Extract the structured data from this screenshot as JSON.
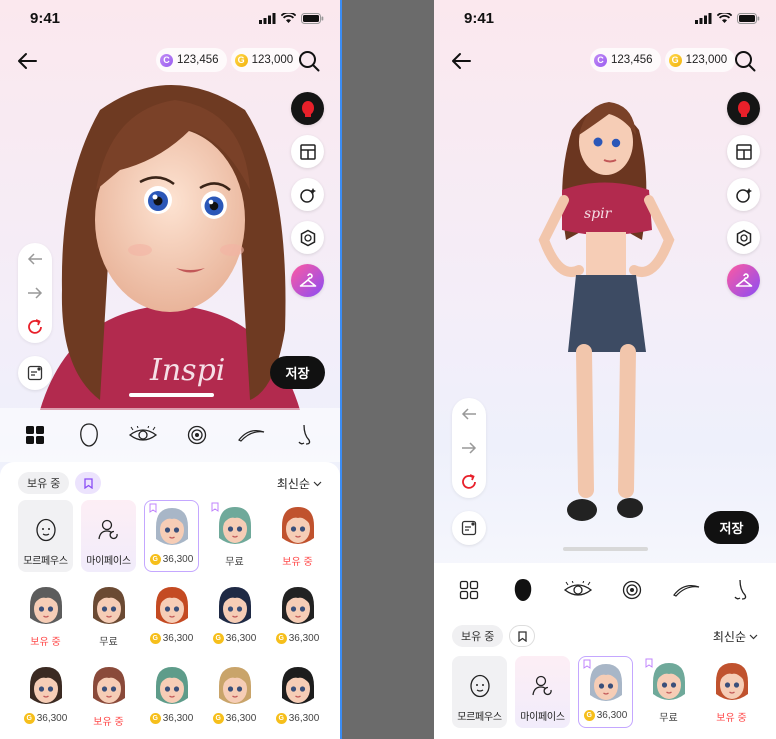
{
  "status": {
    "time": "9:41"
  },
  "currency": {
    "gem": "123,456",
    "gold": "123,000",
    "gem_symbol": "C",
    "gold_symbol": "G"
  },
  "actions": {
    "save_label": "저장"
  },
  "filter": {
    "owned_label": "보유 중",
    "sort_label": "최신순"
  },
  "items_left": [
    {
      "type": "tile",
      "label": "모르페우스",
      "icon": "face-outline-icon"
    },
    {
      "type": "tile",
      "label": "마이페이스",
      "icon": "person-refresh-icon"
    },
    {
      "type": "face",
      "price": "36,300",
      "selected": true,
      "hair": "#a8b6c7",
      "bookmark": true
    },
    {
      "type": "face",
      "label": "무료",
      "hair": "#6fa99a",
      "bookmark": true
    },
    {
      "type": "face",
      "label": "보유 중",
      "owned": true,
      "hair": "#c0522e"
    },
    {
      "type": "face",
      "label": "보유 중",
      "owned": true,
      "hair": "#5c5c5c"
    },
    {
      "type": "face",
      "label": "무료",
      "hair": "#6b4a33"
    },
    {
      "type": "face",
      "price": "36,300",
      "hair": "#c44a22"
    },
    {
      "type": "face",
      "price": "36,300",
      "hair": "#1f2a45"
    },
    {
      "type": "face",
      "price": "36,300",
      "hair": "#222222"
    },
    {
      "type": "face",
      "price": "36,300",
      "hair": "#3b2a22"
    },
    {
      "type": "face",
      "label": "보유 중",
      "owned": true,
      "hair": "#8a4a3a"
    },
    {
      "type": "face",
      "price": "36,300",
      "hair": "#5e9c8a"
    },
    {
      "type": "face",
      "price": "36,300",
      "hair": "#c9a46a"
    },
    {
      "type": "face",
      "price": "36,300",
      "hair": "#1d1d1d"
    }
  ],
  "items_right": [
    {
      "type": "tile",
      "label": "모르페우스",
      "icon": "face-outline-icon"
    },
    {
      "type": "tile",
      "label": "마이페이스",
      "icon": "person-refresh-icon"
    },
    {
      "type": "face",
      "price": "36,300",
      "selected": true,
      "hair": "#a8b6c7",
      "bookmark": true
    },
    {
      "type": "face",
      "label": "무료",
      "hair": "#6fa99a",
      "bookmark": true
    },
    {
      "type": "face",
      "label": "보유 중",
      "owned": true,
      "hair": "#c0522e"
    }
  ],
  "colors": {
    "owned": "#ff4a4a",
    "accent": "#8a4df5",
    "selected_border": "#c4a7ff"
  }
}
